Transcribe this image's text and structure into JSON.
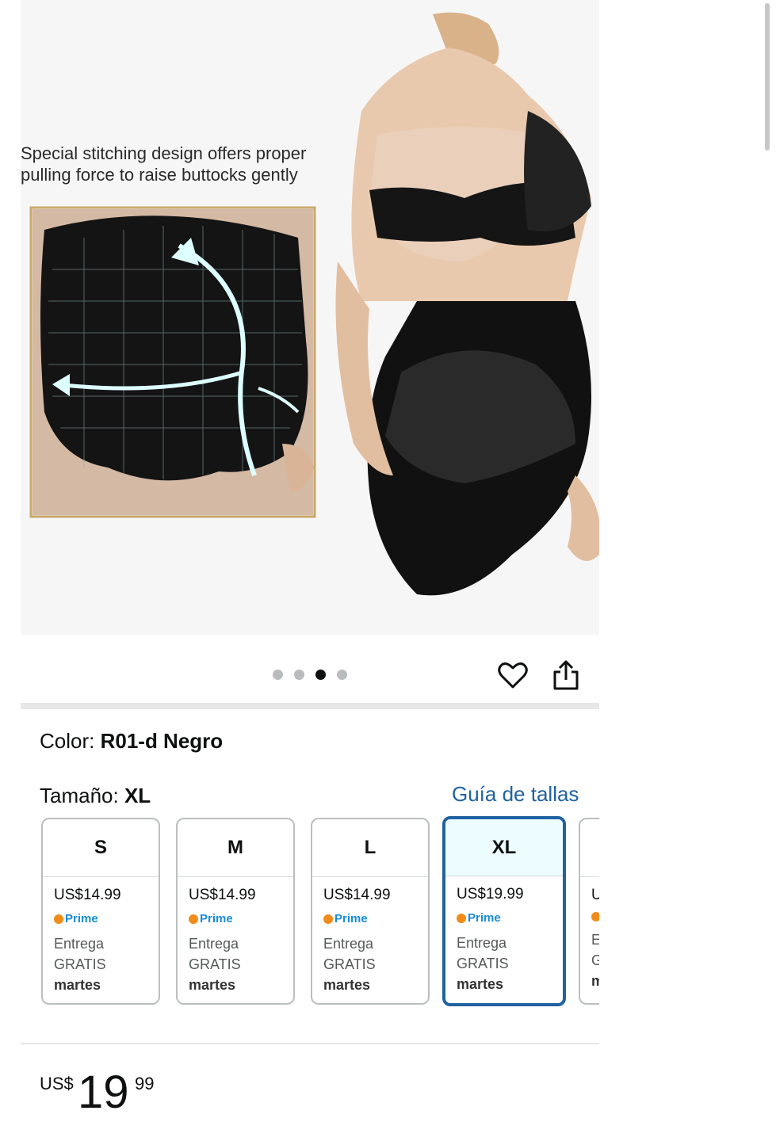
{
  "hero": {
    "caption_line1": "Special stitching design offers proper",
    "caption_line2": "pulling force to raise buttocks gently"
  },
  "carousel": {
    "dot_count": 4,
    "active_index": 2
  },
  "icons": {
    "favorite": "heart-icon",
    "share": "share-icon"
  },
  "color": {
    "label": "Color:",
    "value": "R01-d Negro"
  },
  "size": {
    "label": "Tamaño:",
    "value": "XL",
    "guide_link": "Guía de tallas"
  },
  "sizes": [
    {
      "size": "S",
      "price": "US$14.99",
      "prime": "Prime",
      "delivery1": "Entrega",
      "delivery2": "GRATIS",
      "day": "martes"
    },
    {
      "size": "M",
      "price": "US$14.99",
      "prime": "Prime",
      "delivery1": "Entrega",
      "delivery2": "GRATIS",
      "day": "martes"
    },
    {
      "size": "L",
      "price": "US$14.99",
      "prime": "Prime",
      "delivery1": "Entrega",
      "delivery2": "GRATIS",
      "day": "martes"
    },
    {
      "size": "XL",
      "price": "US$19.99",
      "prime": "Prime",
      "delivery1": "Entrega",
      "delivery2": "GRATIS",
      "day": "martes"
    },
    {
      "size": "",
      "price": "U",
      "prime": "",
      "delivery1": "E",
      "delivery2": "G",
      "day": "m"
    }
  ],
  "price": {
    "currency": "US$",
    "whole": "19",
    "fraction": "99"
  },
  "colors": {
    "link": "#2162a1",
    "selected_bg": "#edfdff",
    "prime_blue": "#1a8cd8",
    "prime_orange": "#f08c1a"
  }
}
